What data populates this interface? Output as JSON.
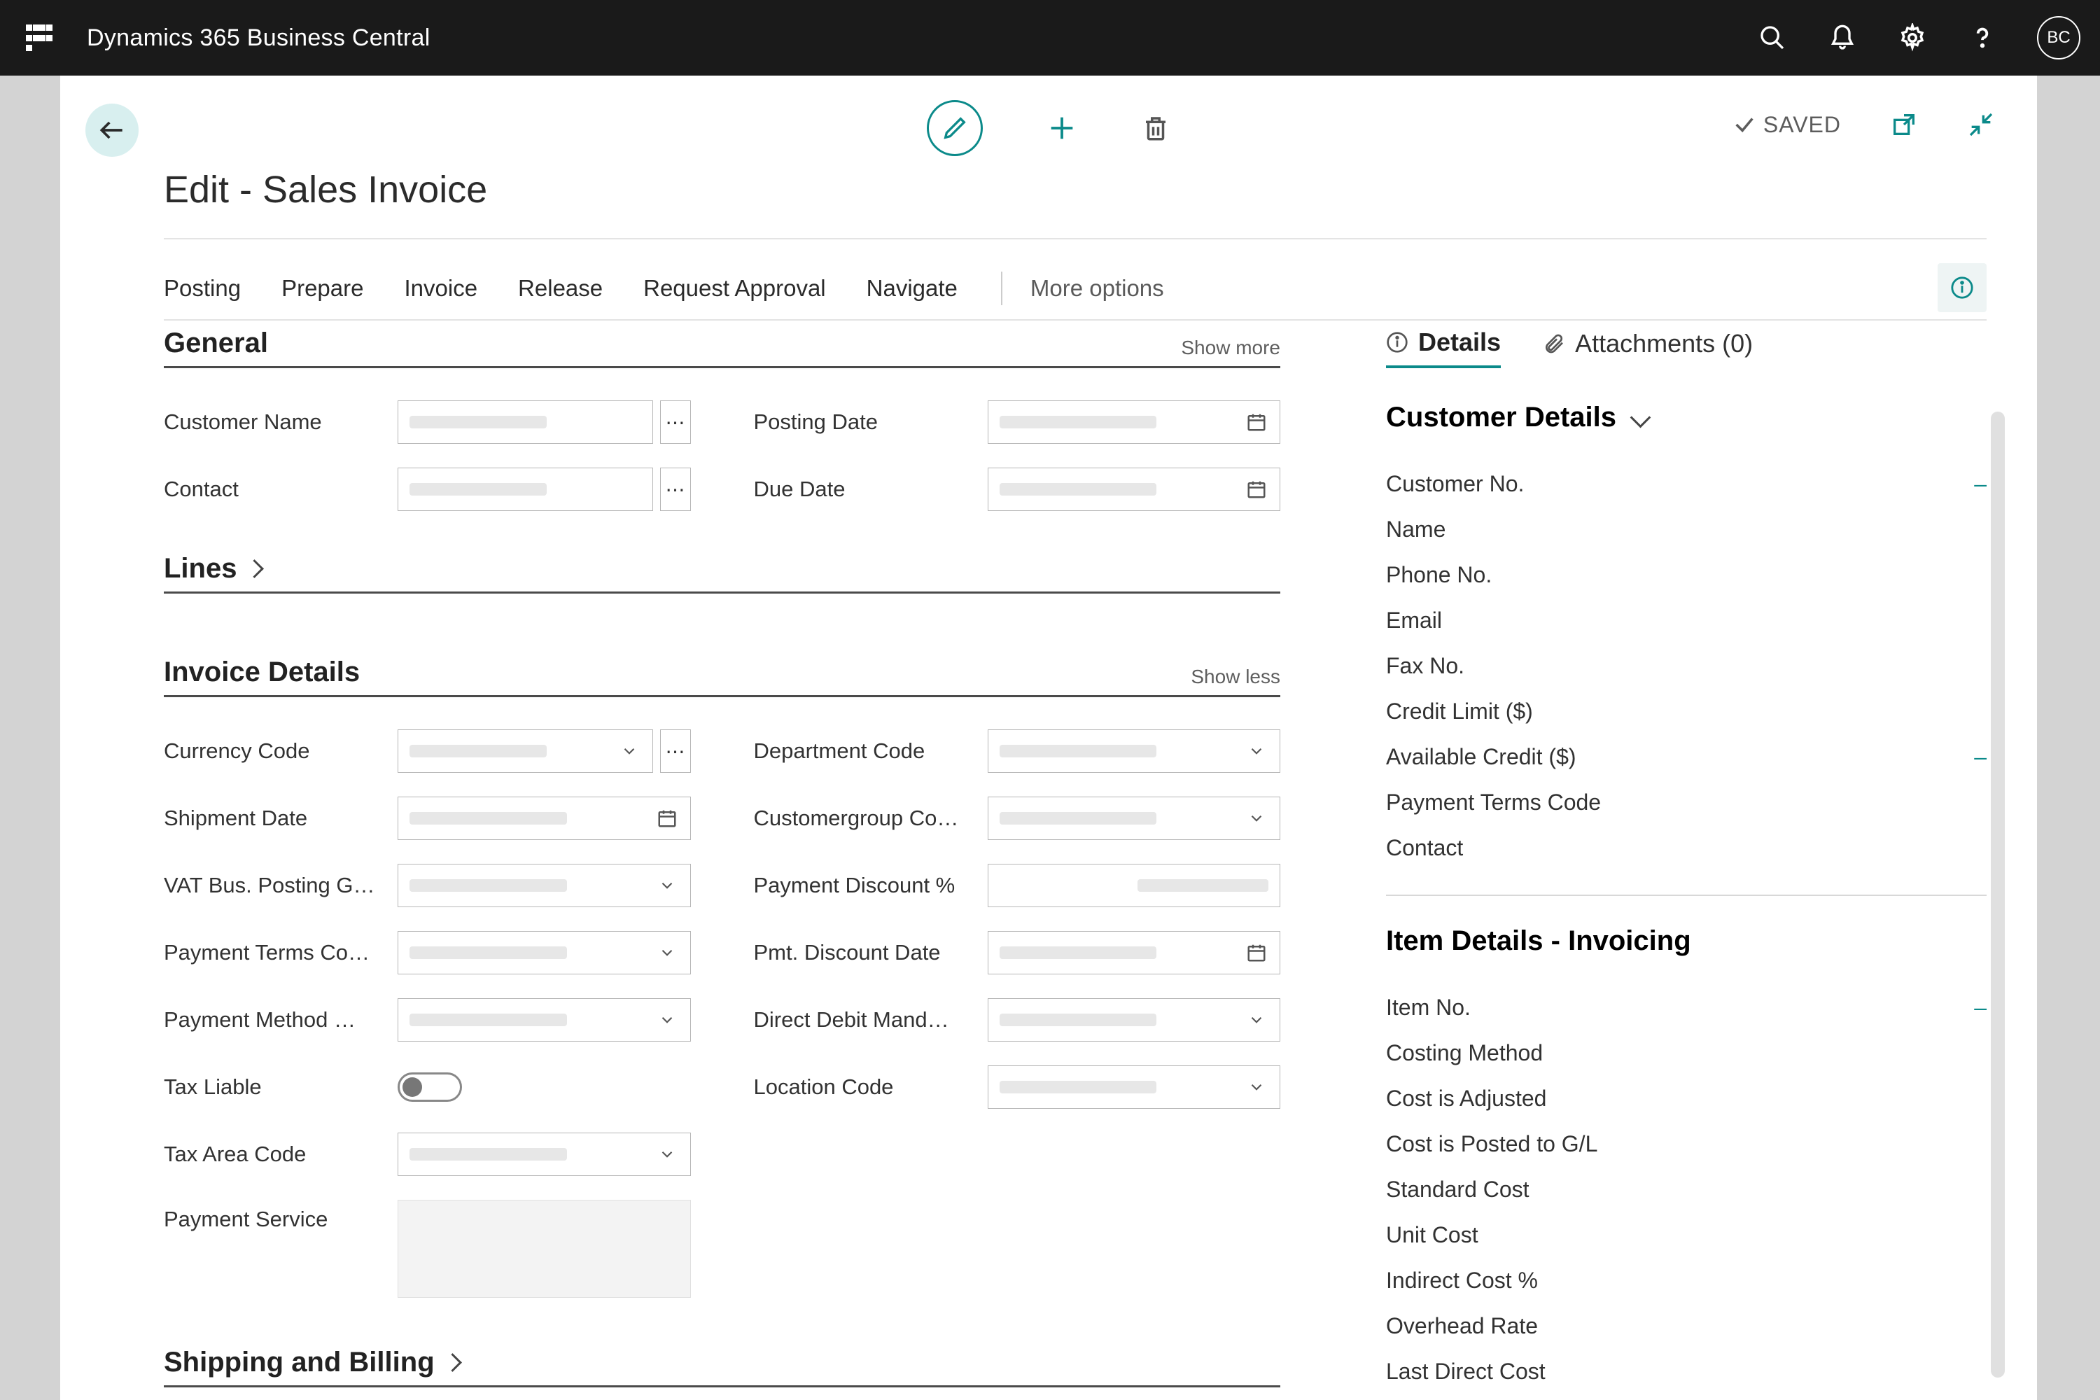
{
  "topbar": {
    "brand": "Dynamics 365 Business Central",
    "avatar_initials": "BC"
  },
  "page": {
    "title": "Edit - Sales Invoice",
    "saved_label": "SAVED"
  },
  "ribbon": {
    "tabs": [
      "Posting",
      "Prepare",
      "Invoice",
      "Release",
      "Request Approval",
      "Navigate"
    ],
    "more_label": "More options"
  },
  "sections": {
    "general": {
      "title": "General",
      "toggle": "Show more"
    },
    "lines": {
      "title": "Lines"
    },
    "invoice_details": {
      "title": "Invoice Details",
      "toggle": "Show less"
    },
    "shipping": {
      "title": "Shipping and Billing"
    }
  },
  "general_fields": {
    "customer_name": "Customer Name",
    "contact": "Contact",
    "posting_date": "Posting Date",
    "due_date": "Due Date"
  },
  "invoice_fields_left": {
    "currency_code": "Currency Code",
    "shipment_date": "Shipment Date",
    "vat_bus": "VAT Bus. Posting G…",
    "payment_terms": "Payment Terms Co…",
    "payment_method": "Payment Method …",
    "tax_liable": "Tax Liable",
    "tax_area": "Tax Area Code",
    "payment_service": "Payment Service"
  },
  "invoice_fields_right": {
    "department_code": "Department Code",
    "customergroup": "Customergroup Co…",
    "payment_discount_pct": "Payment Discount %",
    "pmt_discount_date": "Pmt. Discount Date",
    "direct_debit": "Direct Debit Mand…",
    "location_code": "Location Code"
  },
  "factbox": {
    "tabs": {
      "details": "Details",
      "attachments": "Attachments (0)"
    },
    "customer_details": {
      "title": "Customer Details",
      "rows": [
        "Customer No.",
        "Name",
        "Phone No.",
        "Email",
        "Fax No.",
        "Credit Limit ($)",
        "Available Credit ($)",
        "Payment Terms Code",
        "Contact"
      ]
    },
    "item_details": {
      "title": "Item Details - Invoicing",
      "rows": [
        "Item No.",
        "Costing Method",
        "Cost is Adjusted",
        "Cost is Posted to G/L",
        "Standard Cost",
        "Unit Cost",
        "Indirect Cost %",
        "Overhead Rate",
        "Last Direct Cost"
      ]
    }
  }
}
